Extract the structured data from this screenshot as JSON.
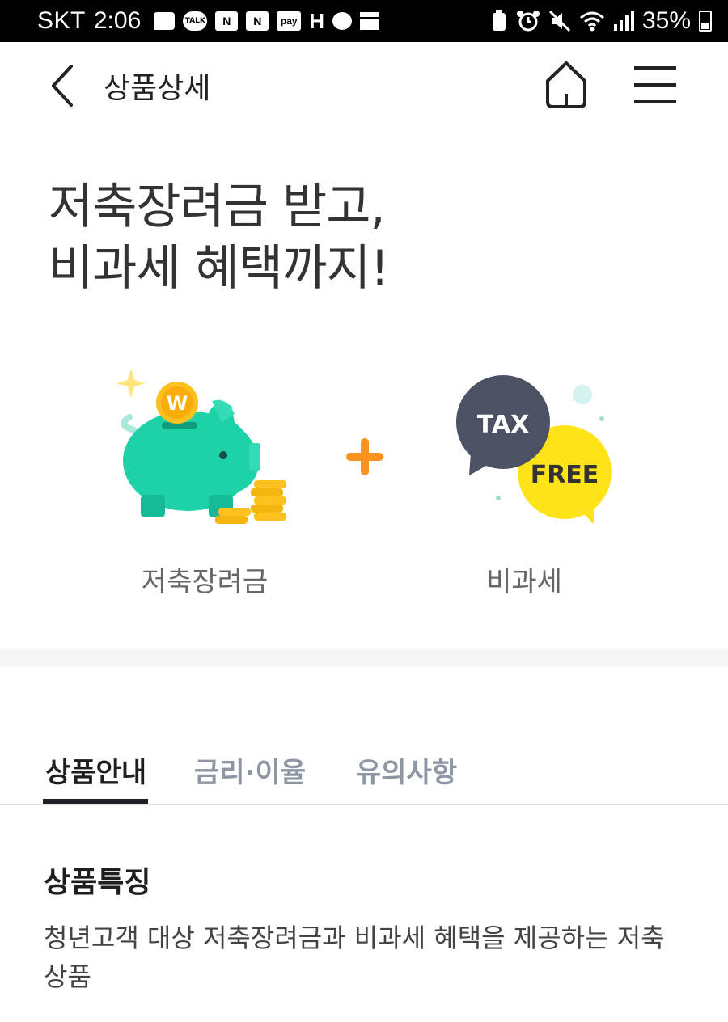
{
  "status_bar": {
    "carrier": "SKT",
    "time": "2:06",
    "notif_talk": "TALK",
    "notif_n1": "N",
    "notif_n2": "N",
    "notif_pay": "pay",
    "notif_h": "H",
    "battery_percent": "35%"
  },
  "header": {
    "title": "상품상세"
  },
  "hero": {
    "title_line1": "저축장려금 받고,",
    "title_line2": "비과세 혜택까지!",
    "benefit1_label": "저축장려금",
    "benefit2_label": "비과세",
    "coin_symbol": "W",
    "tax_text": "TAX",
    "free_text": "FREE"
  },
  "tabs": [
    {
      "label": "상품안내"
    },
    {
      "label": "금리·이율"
    },
    {
      "label": "유의사항"
    }
  ],
  "section": {
    "title": "상품특징",
    "description": "청년고객 대상 저축장려금과 비과세 혜택을 제공하는 저축 상품"
  },
  "colors": {
    "piggy": "#1ed2a8",
    "coin": "#fcc01f",
    "plus": "#f7931e",
    "tax_bubble": "#4c5263",
    "free_bubble": "#fde317",
    "tab_active": "#1e1e1e",
    "tab_inactive": "#8e96a4"
  }
}
